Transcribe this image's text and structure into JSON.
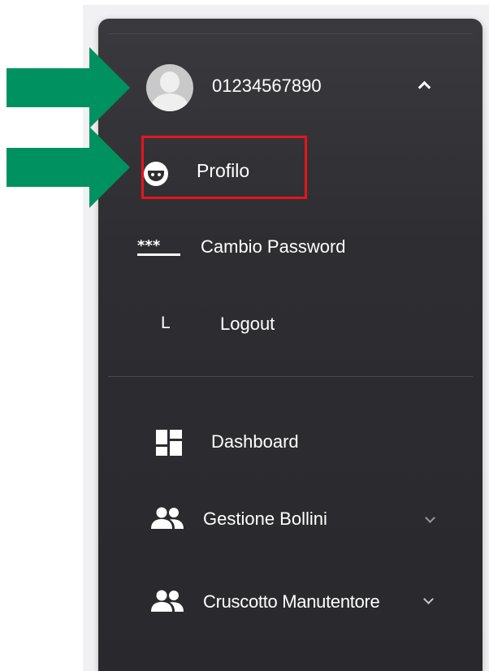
{
  "user": {
    "name": "01234567890"
  },
  "menu": {
    "profile_label": "Profilo",
    "password_label": "Cambio Password",
    "logout_letter": "L",
    "logout_label": "Logout",
    "dashboard_label": "Dashboard",
    "gestione_label": "Gestione Bollini",
    "cruscotto_label": "Cruscotto Manutentore"
  },
  "icons": {
    "password_icon_text": "***"
  },
  "colors": {
    "arrow": "#009160",
    "highlight_box": "#e8141b",
    "sidebar": "#2e2e32"
  }
}
